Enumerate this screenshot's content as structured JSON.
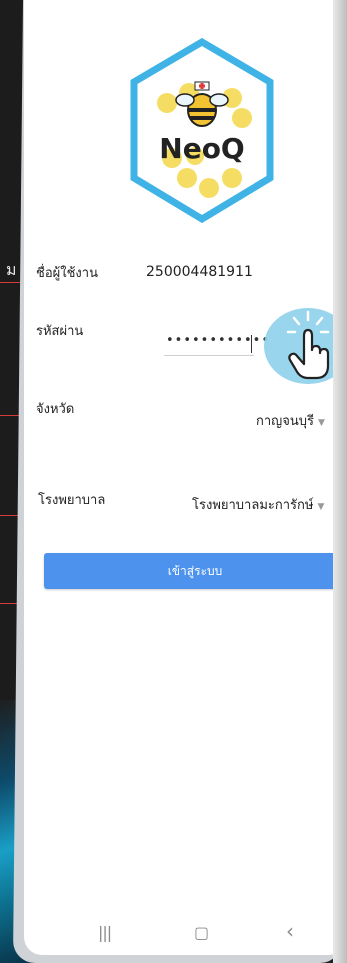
{
  "background": {
    "partial_glyph": "ม",
    "accent_color": "#d43a3a"
  },
  "logo": {
    "text": "NeoQ",
    "icon": "bee-nurse-icon",
    "colors": {
      "border": "#3fb3e6",
      "honeycomb": "#f4d84a",
      "text": "#222222"
    }
  },
  "form": {
    "username_label": "ชื่อผู้ใช้งาน",
    "username_value": "250004481911",
    "password_label": "รหัสผ่าน",
    "password_value": "••••••••••••",
    "province_label": "จังหวัด",
    "province_value": "กาญจนบุรี",
    "hospital_label": "โรงพยาบาล",
    "hospital_value": "โรงพยาบาลมะการักษ์"
  },
  "login_button": {
    "label": "เข้าสู่ระบบ",
    "color": "#4d93ee"
  },
  "overlay": {
    "icon": "tap-hand-icon"
  },
  "navbar": {
    "recent_icon": "|||",
    "home_icon": "▢",
    "back_icon": "‹"
  }
}
